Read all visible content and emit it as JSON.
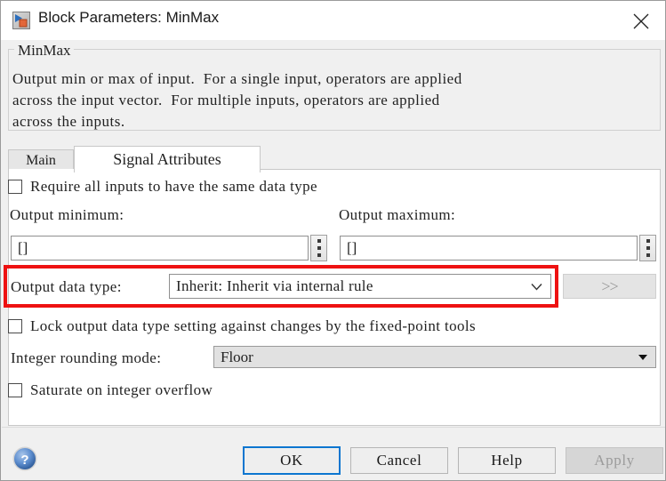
{
  "window": {
    "title": "Block Parameters: MinMax",
    "icon": "simulink-block-icon",
    "close_icon": "close-icon"
  },
  "group": {
    "label": "MinMax",
    "description": "Output min or max of input.  For a single input, operators are applied\nacross the input vector.  For multiple inputs, operators are applied\nacross the inputs."
  },
  "tabs": [
    {
      "label": "Main",
      "active": false
    },
    {
      "label": "Signal Attributes",
      "active": true
    }
  ],
  "form": {
    "require_same_type": {
      "label": "Require all inputs to have the same data type",
      "checked": false
    },
    "output_minimum": {
      "label": "Output minimum:",
      "value": "[]",
      "picker_icon": "vertical-dots-icon"
    },
    "output_maximum": {
      "label": "Output maximum:",
      "value": "[]",
      "picker_icon": "vertical-dots-icon"
    },
    "output_data_type": {
      "label": "Output data type:",
      "value": "Inherit: Inherit via internal rule",
      "chevron_icon": "chevron-down-icon",
      "expand_label": ">>",
      "expand_enabled": false,
      "highlighted": true,
      "highlight_color": "#ee1111"
    },
    "lock_output_type": {
      "label": "Lock output data type setting against changes by the fixed-point tools",
      "checked": false
    },
    "integer_rounding_mode": {
      "label": "Integer rounding mode:",
      "value": "Floor",
      "arrow_icon": "triangle-down-icon"
    },
    "saturate_overflow": {
      "label": "Saturate on integer overflow",
      "checked": false
    }
  },
  "footer": {
    "help_icon": "help-circle-icon",
    "buttons": [
      {
        "label": "OK",
        "state": "default-focused"
      },
      {
        "label": "Cancel",
        "state": "enabled"
      },
      {
        "label": "Help",
        "state": "enabled"
      },
      {
        "label": "Apply",
        "state": "disabled"
      }
    ]
  },
  "colors": {
    "accent": "#0b76d0",
    "highlight": "#ee1111",
    "dialog_bg": "#f0f0f0",
    "panel_bg": "#ffffff"
  }
}
